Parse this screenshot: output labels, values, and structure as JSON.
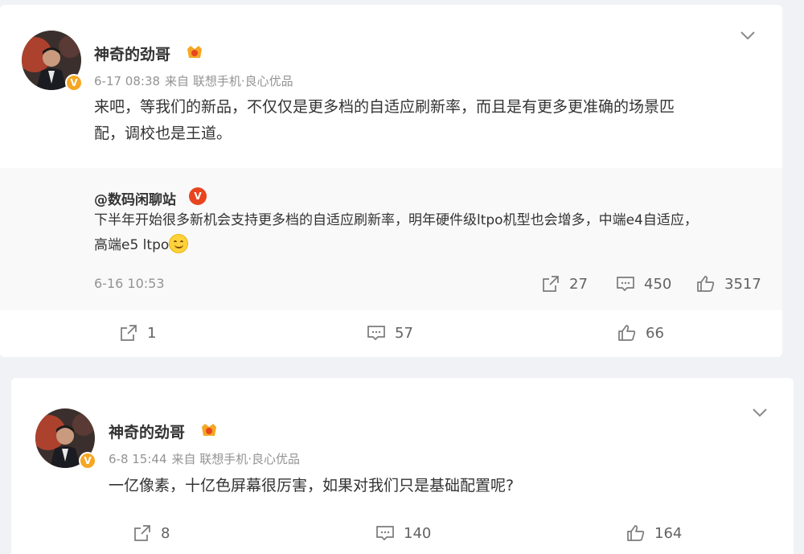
{
  "posts": [
    {
      "author": "神奇的劲哥",
      "time": "6-17 08:38",
      "source": "来自 联想手机·良心优品",
      "text_line1": "来吧，等我们的新品，不仅仅是更多档的自适应刷新率，而且是有更多更准确的场景匹",
      "text_line2": "配，调校也是王道。",
      "quote": {
        "author": "@数码闲聊站",
        "text_line1": "下半年开始很多新机会支持更多档的自适应刷新率，明年硬件级ltpo机型也会增多，中端e4自适应，",
        "text_line2": "高端e5 ltpo",
        "time": "6-16 10:53",
        "reposts": "27",
        "comments": "450",
        "likes": "3517"
      },
      "reposts": "1",
      "comments": "57",
      "likes": "66"
    },
    {
      "author": "神奇的劲哥",
      "time": "6-8 15:44",
      "source": "来自 联想手机·良心优品",
      "text_line1": "一亿像素，十亿色屏幕很厉害，如果对我们只是基础配置呢?",
      "reposts": "8",
      "comments": "140",
      "likes": "164"
    }
  ],
  "colors": {
    "text": "#333333",
    "meta": "#939393",
    "vip_badge": "#f5a623",
    "quote_bg": "#f9f9fa"
  },
  "icons": [
    "chevron-down-icon",
    "repost-icon",
    "comment-icon",
    "like-icon",
    "verified-icon"
  ]
}
